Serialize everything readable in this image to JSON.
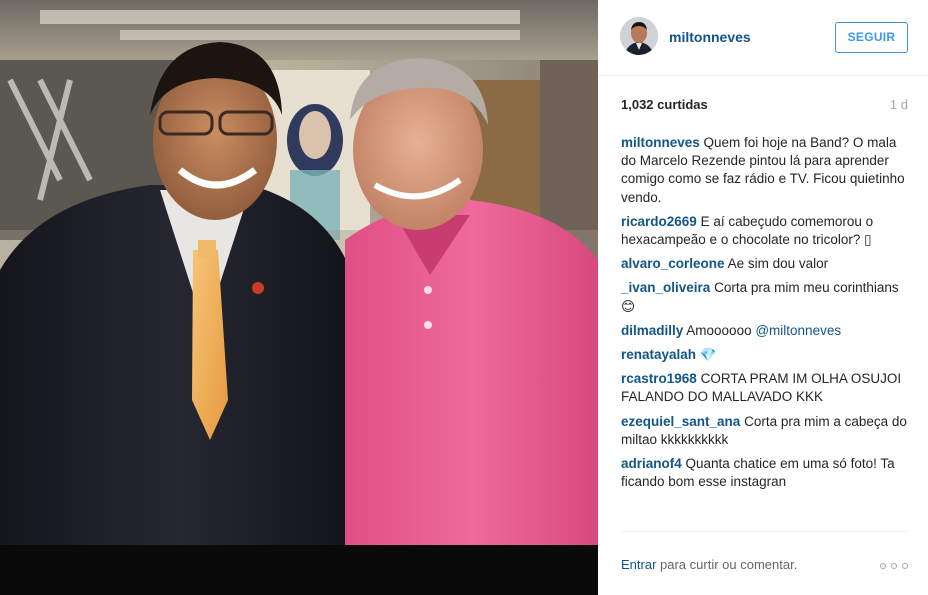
{
  "post": {
    "username": "miltonneves",
    "follow_label": "SEGUIR",
    "likes": "1,032 curtidas",
    "time": "1 d"
  },
  "comments": [
    {
      "user": "miltonneves",
      "text": " Quem foi hoje na Band? O mala do Marcelo Rezende pintou lá para aprender comigo como se faz rádio e TV. Ficou quietinho vendo."
    },
    {
      "user": "ricardo2669",
      "text": " E aí cabeçudo comemorou o hexacampeão e o chocolate no tricolor? ▯"
    },
    {
      "user": "alvaro_corleone",
      "text": " Ae sim dou valor"
    },
    {
      "user": "_ivan_oliveira",
      "text": " Corta pra mim meu corinthians 😊"
    },
    {
      "user": "dilmadilly",
      "text": " Amoooooo ",
      "mention": "@miltonneves"
    },
    {
      "user": "renatayalah",
      "text": " 💎"
    },
    {
      "user": "rcastro1968",
      "text": " CORTA PRAM IM OLHA OSUJOI FALANDO DO MALLAVADO KKK"
    },
    {
      "user": "ezequiel_sant_ana",
      "text": " Corta pra mim a cabeça do miltao kkkkkkkkkk"
    },
    {
      "user": "adrianof4",
      "text": " Quanta chatice em uma só foto! Ta ficando bom esse instagran"
    }
  ],
  "footer": {
    "login_link": "Entrar",
    "prompt": " para curtir ou comentar."
  },
  "icons": {
    "more": "more-options-icon",
    "avatar": "profile-avatar"
  },
  "colors": {
    "link": "#125688",
    "follow": "#3897f0",
    "muted": "#a5a7aa"
  }
}
